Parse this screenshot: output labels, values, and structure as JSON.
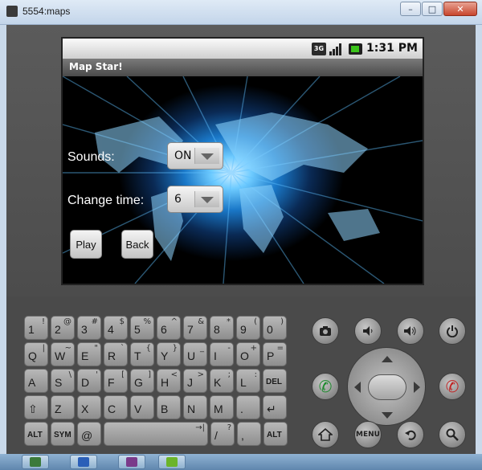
{
  "window": {
    "title": "5554:maps",
    "min_label": "–",
    "max_label": "□",
    "close_label": "✕"
  },
  "status": {
    "network": "3G",
    "time": "1:31 PM"
  },
  "app": {
    "title": "Map Star!",
    "sounds_label": "Sounds:",
    "sounds_value": "ON",
    "change_time_label": "Change time:",
    "change_time_value": "6",
    "play_button": "Play",
    "back_button": "Back"
  },
  "keyboard": {
    "rows": [
      [
        {
          "main": "1",
          "alt": "!"
        },
        {
          "main": "2",
          "alt": "@"
        },
        {
          "main": "3",
          "alt": "#"
        },
        {
          "main": "4",
          "alt": "$"
        },
        {
          "main": "5",
          "alt": "%"
        },
        {
          "main": "6",
          "alt": "^"
        },
        {
          "main": "7",
          "alt": "&"
        },
        {
          "main": "8",
          "alt": "*"
        },
        {
          "main": "9",
          "alt": "("
        },
        {
          "main": "0",
          "alt": ")"
        }
      ],
      [
        {
          "main": "Q",
          "alt": "|"
        },
        {
          "main": "W",
          "alt": "~"
        },
        {
          "main": "E",
          "alt": "\""
        },
        {
          "main": "R",
          "alt": "`"
        },
        {
          "main": "T",
          "alt": "{"
        },
        {
          "main": "Y",
          "alt": "}"
        },
        {
          "main": "U",
          "alt": "_"
        },
        {
          "main": "I",
          "alt": "-"
        },
        {
          "main": "O",
          "alt": "+"
        },
        {
          "main": "P",
          "alt": "="
        }
      ],
      [
        {
          "main": "A",
          "alt": ""
        },
        {
          "main": "S",
          "alt": "\\"
        },
        {
          "main": "D",
          "alt": "'"
        },
        {
          "main": "F",
          "alt": "["
        },
        {
          "main": "G",
          "alt": "]"
        },
        {
          "main": "H",
          "alt": "<"
        },
        {
          "main": "J",
          "alt": ">"
        },
        {
          "main": "K",
          "alt": ";"
        },
        {
          "main": "L",
          "alt": ":"
        },
        {
          "main": "DEL",
          "alt": ""
        }
      ],
      [
        {
          "main": "⇧",
          "alt": ""
        },
        {
          "main": "Z",
          "alt": ""
        },
        {
          "main": "X",
          "alt": ""
        },
        {
          "main": "C",
          "alt": ""
        },
        {
          "main": "V",
          "alt": ""
        },
        {
          "main": "B",
          "alt": ""
        },
        {
          "main": "N",
          "alt": ""
        },
        {
          "main": "M",
          "alt": ""
        },
        {
          "main": ".",
          "alt": ""
        },
        {
          "main": "↵",
          "alt": ""
        }
      ],
      [
        {
          "main": "ALT",
          "alt": ""
        },
        {
          "main": "SYM",
          "alt": ""
        },
        {
          "main": "@",
          "alt": ""
        },
        {
          "main": "",
          "alt": "→|"
        },
        {
          "main": "/",
          "alt": "?"
        },
        {
          "main": ",",
          "alt": ""
        },
        {
          "main": "ALT",
          "alt": ""
        }
      ]
    ]
  },
  "controls": {
    "menu_label": "MENU"
  },
  "colors": {
    "call": "#1c8a2c",
    "end_call": "#c02222"
  }
}
